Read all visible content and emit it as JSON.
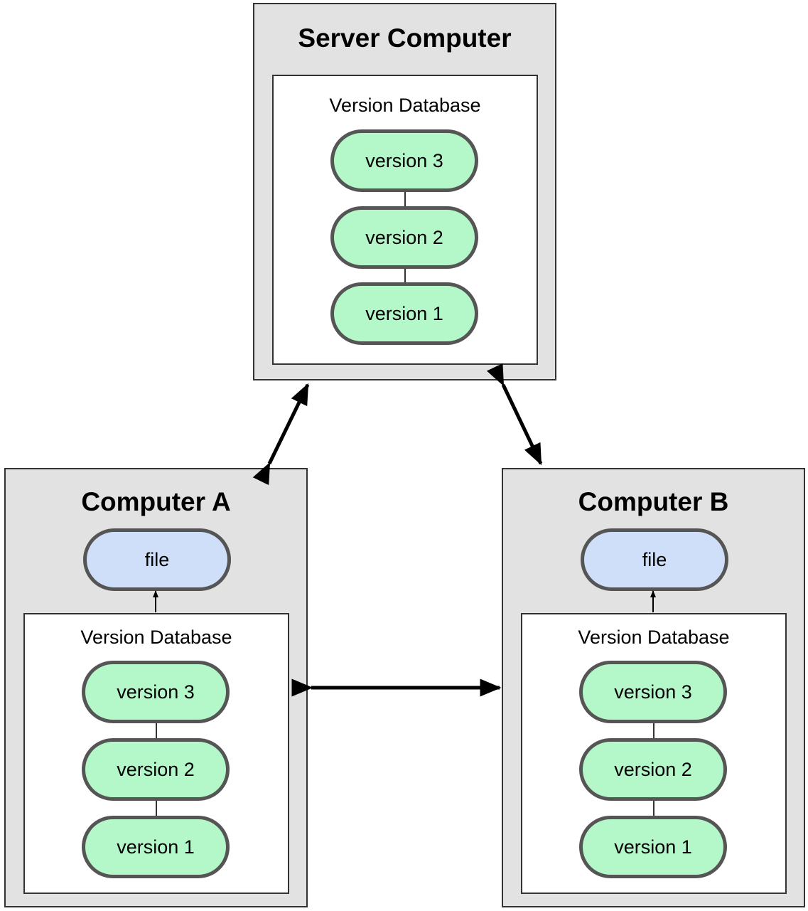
{
  "server": {
    "title": "Server Computer",
    "database_label": "Version Database",
    "versions": [
      "version 3",
      "version 2",
      "version 1"
    ]
  },
  "computer_a": {
    "title": "Computer A",
    "file_label": "file",
    "database_label": "Version Database",
    "versions": [
      "version 3",
      "version 2",
      "version 1"
    ]
  },
  "computer_b": {
    "title": "Computer B",
    "file_label": "file",
    "database_label": "Version Database",
    "versions": [
      "version 3",
      "version 2",
      "version 1"
    ]
  },
  "colors": {
    "box_fill": "#e2e2e2",
    "version_fill": "#b4f7c9",
    "file_fill": "#d0dff9",
    "pill_border": "#555555"
  }
}
